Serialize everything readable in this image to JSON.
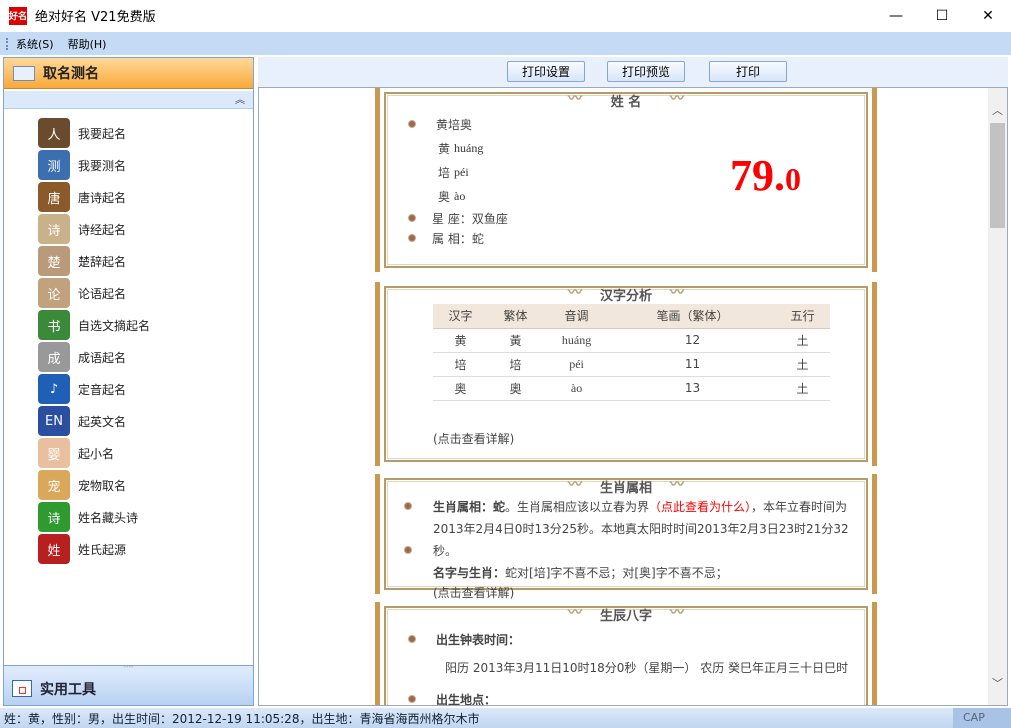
{
  "window": {
    "title": "绝对好名 V21免费版",
    "logo": "好名",
    "minimize": "—",
    "maximize": "☐",
    "close": "✕"
  },
  "menu": [
    "系统(S)",
    "帮助(H)"
  ],
  "sidebar": {
    "header": "取名测名",
    "collapse": "︽",
    "items": [
      {
        "label": "我要起名",
        "icon": "person-icon",
        "color": "#6b4b2e",
        "glyph": "人"
      },
      {
        "label": "我要测名",
        "icon": "magnifier-icon",
        "color": "#3b6fb0",
        "glyph": "测"
      },
      {
        "label": "唐诗起名",
        "icon": "tang-poem-icon",
        "color": "#8b5a2b",
        "glyph": "唐"
      },
      {
        "label": "诗经起名",
        "icon": "shijing-icon",
        "color": "#c9b28a",
        "glyph": "诗"
      },
      {
        "label": "楚辞起名",
        "icon": "chuci-icon",
        "color": "#b99a7a",
        "glyph": "楚"
      },
      {
        "label": "论语起名",
        "icon": "lunyu-icon",
        "color": "#c2a27c",
        "glyph": "论"
      },
      {
        "label": "自选文摘起名",
        "icon": "books-icon",
        "color": "#3a8a3a",
        "glyph": "书"
      },
      {
        "label": "成语起名",
        "icon": "idiom-icon",
        "color": "#999",
        "glyph": "成"
      },
      {
        "label": "定音起名",
        "icon": "speaker-icon",
        "color": "#1f5fb5",
        "glyph": "♪"
      },
      {
        "label": "起英文名",
        "icon": "uk-flag-icon",
        "color": "#2a4ea0",
        "glyph": "EN"
      },
      {
        "label": "起小名",
        "icon": "baby-icon",
        "color": "#e8c0a0",
        "glyph": "婴"
      },
      {
        "label": "宠物取名",
        "icon": "dog-icon",
        "color": "#d9a85b",
        "glyph": "宠"
      },
      {
        "label": "姓名藏头诗",
        "icon": "poem-icon",
        "color": "#2f9a2f",
        "glyph": "诗"
      },
      {
        "label": "姓氏起源",
        "icon": "surname-icon",
        "color": "#b82020",
        "glyph": "姓"
      }
    ],
    "footer": "实用工具"
  },
  "toolbar": {
    "print_setup": "打印设置",
    "print_preview": "打印预览",
    "print": "打印"
  },
  "name_section": {
    "title": "姓 名",
    "full_name": "黄培奥",
    "chars": [
      {
        "char": "黄",
        "pinyin": "huáng"
      },
      {
        "char": "培",
        "pinyin": "péi"
      },
      {
        "char": "奥",
        "pinyin": "ào"
      }
    ],
    "constellation": "星 座：双鱼座",
    "zodiac": "属 相：蛇",
    "score_int": "79.",
    "score_dec": "0"
  },
  "hanzi_section": {
    "title": "汉字分析",
    "headers": [
      "汉字",
      "繁体",
      "音调",
      "笔画（繁体）",
      "五行"
    ],
    "rows": [
      [
        "黄",
        "黃",
        "huáng",
        "12",
        "土"
      ],
      [
        "培",
        "培",
        "péi",
        "11",
        "土"
      ],
      [
        "奥",
        "奧",
        "ào",
        "13",
        "土"
      ]
    ],
    "detail_link": "(点击查看详解)"
  },
  "zodiac_section": {
    "title": "生肖属相",
    "label1": "生肖属相：蛇",
    "text1a": "。生肖属相应该以立春为界",
    "link1": "（点此查看为什么）",
    "text1b": "，本年立春时间为2013年2月4日0时13分25秒。本地真太阳时时间2013年2月3日23时21分32秒。",
    "label2": "名字与生肖：",
    "text2": "蛇对[培]字不喜不忌；对[奥]字不喜不忌；",
    "detail_link": "(点击查看详解)"
  },
  "bazi_section": {
    "title": "生辰八字",
    "label1": "出生钟表时间：",
    "time": "阳历  2013年3月11日10时18分0秒（星期一）  农历  癸巳年正月三十日巳时",
    "label2": "出生地点："
  },
  "status": {
    "text": "姓：黄，性别：男，出生时间：2012-12-19 11:05:28，出生地：青海省海西州格尔木市",
    "cap": "CAP"
  }
}
